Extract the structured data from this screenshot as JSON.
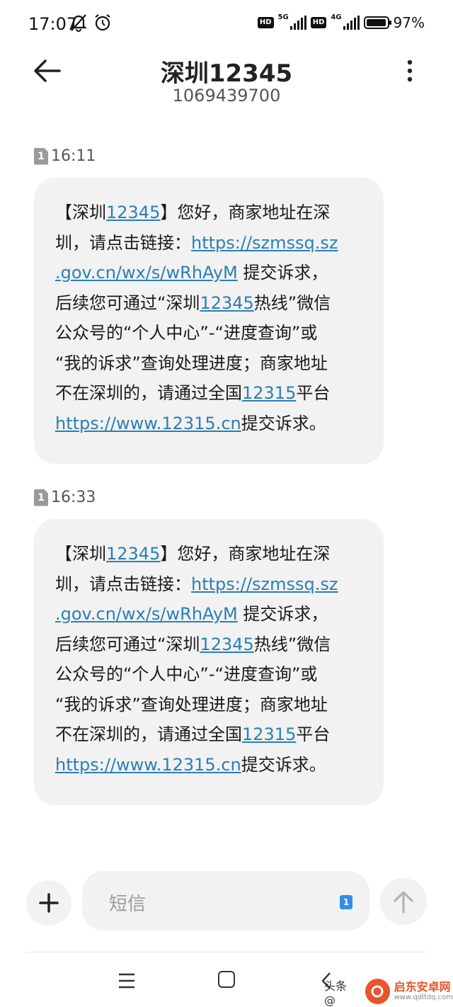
{
  "status_bar": {
    "time": "17:07",
    "network_1": "5G",
    "network_2": "4G",
    "hd_label": "HD",
    "battery_level": 97,
    "battery_text": "97%"
  },
  "header": {
    "title": "深圳12345",
    "subtitle": "1069439700"
  },
  "messages": [
    {
      "sim": "1",
      "time": "16:11",
      "lines": [
        [
          {
            "t": "【深圳"
          },
          {
            "t": "12345",
            "link": true
          },
          {
            "t": "】您好，商家地址在深"
          }
        ],
        [
          {
            "t": "圳，请点击链接："
          },
          {
            "t": "https://szmssq.sz",
            "link": true
          }
        ],
        [
          {
            "t": ".gov.cn/wx/s/wRhAyM",
            "link": true
          },
          {
            "t": " 提交诉求，"
          }
        ],
        [
          {
            "t": "后续您可通过“深圳"
          },
          {
            "t": "12345",
            "link": true
          },
          {
            "t": "热线”微信"
          }
        ],
        [
          {
            "t": "公众号的“个人中心”-“进度查询”或"
          }
        ],
        [
          {
            "t": "“我的诉求”查询处理进度；商家地址"
          }
        ],
        [
          {
            "t": "不在深圳的，请通过全国"
          },
          {
            "t": "12315",
            "link": true
          },
          {
            "t": "平台"
          }
        ],
        [
          {
            "t": "https://www.12315.cn",
            "link": true
          },
          {
            "t": "提交诉求。"
          }
        ]
      ]
    },
    {
      "sim": "1",
      "time": "16:33",
      "lines": [
        [
          {
            "t": "【深圳"
          },
          {
            "t": "12345",
            "link": true
          },
          {
            "t": "】您好，商家地址在深"
          }
        ],
        [
          {
            "t": "圳，请点击链接："
          },
          {
            "t": "https://szmssq.sz",
            "link": true
          }
        ],
        [
          {
            "t": ".gov.cn/wx/s/wRhAyM",
            "link": true
          },
          {
            "t": " 提交诉求，"
          }
        ],
        [
          {
            "t": "后续您可通过“深圳"
          },
          {
            "t": "12345",
            "link": true
          },
          {
            "t": "热线”微信"
          }
        ],
        [
          {
            "t": "公众号的“个人中心”-“进度查询”或"
          }
        ],
        [
          {
            "t": "“我的诉求”查询处理进度；商家地址"
          }
        ],
        [
          {
            "t": "不在深圳的，请通过全国"
          },
          {
            "t": "12315",
            "link": true
          },
          {
            "t": "平台"
          }
        ],
        [
          {
            "t": "https://www.12315.cn",
            "link": true
          },
          {
            "t": "提交诉求。"
          }
        ]
      ]
    }
  ],
  "composer": {
    "placeholder": "短信",
    "sim_badge": "1"
  },
  "watermark": {
    "text": "头条 @",
    "site_name": "启东安卓网",
    "site_url": "www.qdltdq.com"
  },
  "colors": {
    "link": "#2a7fb6",
    "bubble": "#f2f2f2",
    "sim_badge": "#2f8fe8"
  }
}
